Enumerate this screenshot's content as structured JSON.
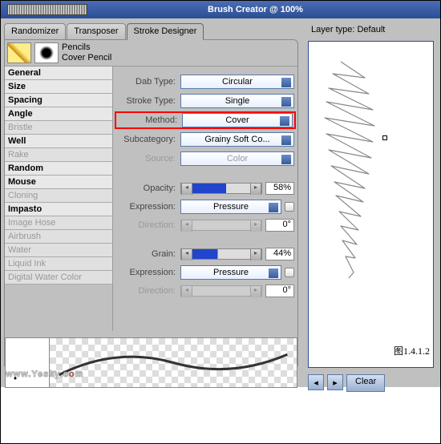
{
  "window": {
    "title": "Brush Creator @ 100%"
  },
  "tabs": {
    "randomizer": "Randomizer",
    "transposer": "Transposer",
    "stroke_designer": "Stroke Designer"
  },
  "brush": {
    "category": "Pencils",
    "variant": "Cover Pencil"
  },
  "categories": {
    "general": "General",
    "size": "Size",
    "spacing": "Spacing",
    "angle": "Angle",
    "bristle": "Bristle",
    "well": "Well",
    "rake": "Rake",
    "random": "Random",
    "mouse": "Mouse",
    "cloning": "Cloning",
    "impasto": "Impasto",
    "image_hose": "Image Hose",
    "airbrush": "Airbrush",
    "water": "Water",
    "liquid_ink": "Liquid Ink",
    "digital_water": "Digital Water Color"
  },
  "form": {
    "dab_type": {
      "label": "Dab Type:",
      "value": "Circular"
    },
    "stroke_type": {
      "label": "Stroke Type:",
      "value": "Single"
    },
    "method": {
      "label": "Method:",
      "value": "Cover"
    },
    "subcategory": {
      "label": "Subcategory:",
      "value": "Grainy Soft Co..."
    },
    "source": {
      "label": "Source:",
      "value": "Color"
    },
    "opacity": {
      "label": "Opacity:",
      "value": "58%"
    },
    "expression1": {
      "label": "Expression:",
      "value": "Pressure"
    },
    "direction1": {
      "label": "Direction:",
      "value": "0°"
    },
    "grain": {
      "label": "Grain:",
      "value": "44%"
    },
    "expression2": {
      "label": "Expression:",
      "value": "Pressure"
    },
    "direction2": {
      "label": "Direction:",
      "value": "0°"
    }
  },
  "right": {
    "layer_type_label": "Layer type:",
    "layer_type_value": "Default",
    "figure_label": "图1.4.1.2",
    "clear": "Clear"
  },
  "watermark": {
    "a": "www.Yesky.c",
    "b": "o",
    "c": "m"
  }
}
